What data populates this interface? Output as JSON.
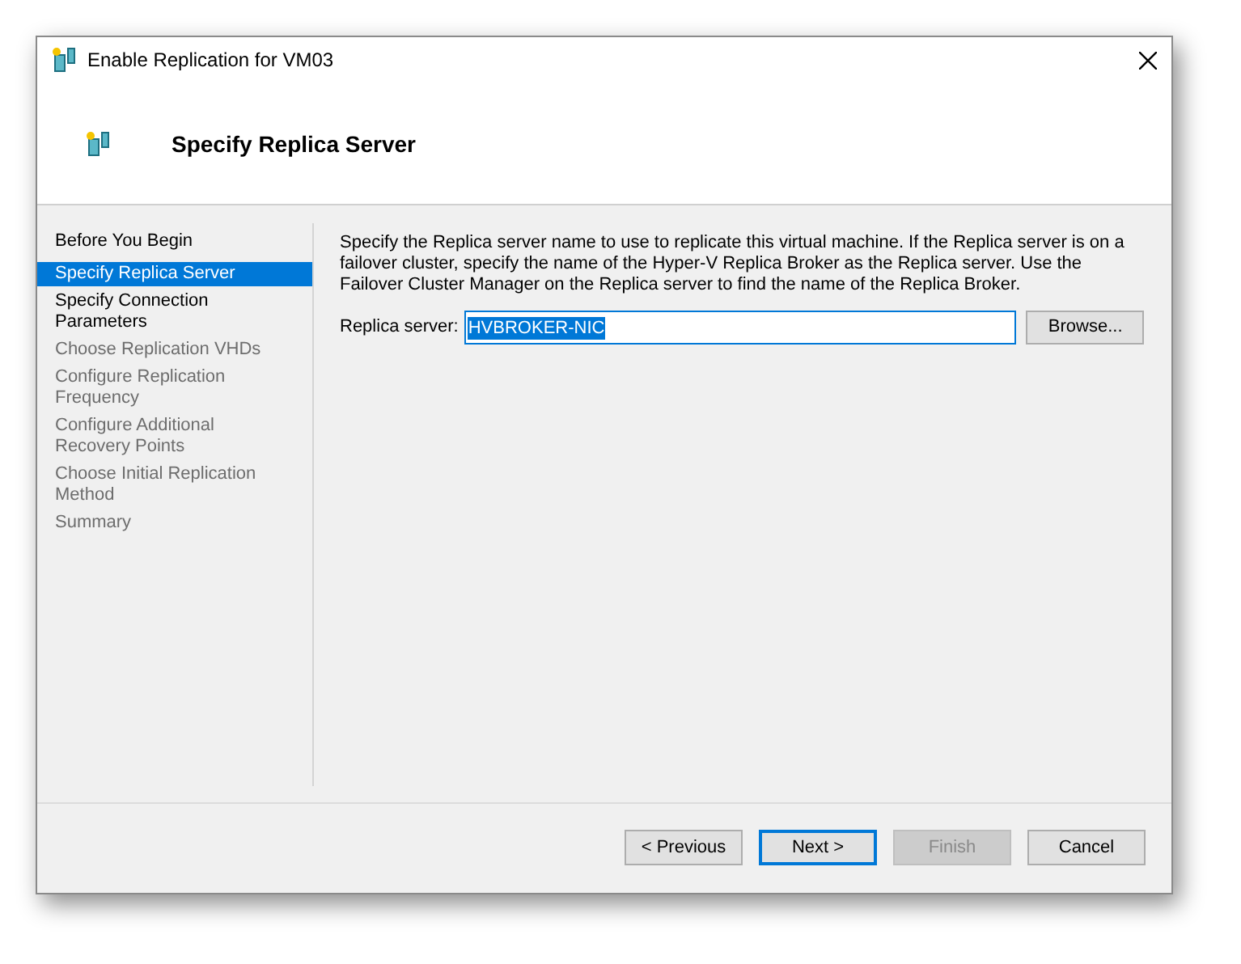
{
  "window": {
    "title": "Enable Replication for VM03"
  },
  "header": {
    "title": "Specify Replica Server"
  },
  "steps": [
    {
      "label": "Before You Begin",
      "selected": false,
      "disabled": false
    },
    {
      "label": "Specify Replica Server",
      "selected": true,
      "disabled": false
    },
    {
      "label": "Specify Connection Parameters",
      "selected": false,
      "disabled": false
    },
    {
      "label": "Choose Replication VHDs",
      "selected": false,
      "disabled": true
    },
    {
      "label": "Configure Replication Frequency",
      "selected": false,
      "disabled": true
    },
    {
      "label": "Configure Additional Recovery Points",
      "selected": false,
      "disabled": true
    },
    {
      "label": "Choose Initial Replication Method",
      "selected": false,
      "disabled": true
    },
    {
      "label": "Summary",
      "selected": false,
      "disabled": true
    }
  ],
  "description": "Specify the Replica server name to use to replicate this virtual machine. If the Replica server is on a failover cluster, specify the name of the Hyper-V Replica Broker as the Replica server. Use the Failover Cluster Manager on the Replica server to find the name of the Replica Broker.",
  "replica_server": {
    "label": "Replica server:",
    "value": "HVBROKER-NIC"
  },
  "browse_button": "Browse...",
  "buttons": [
    {
      "label": "< Previous",
      "selected": false,
      "disabled": false
    },
    {
      "label": "Next >",
      "selected": true,
      "disabled": false
    },
    {
      "label": "Finish",
      "selected": false,
      "disabled": true
    },
    {
      "label": "Cancel",
      "selected": false,
      "disabled": false
    }
  ]
}
